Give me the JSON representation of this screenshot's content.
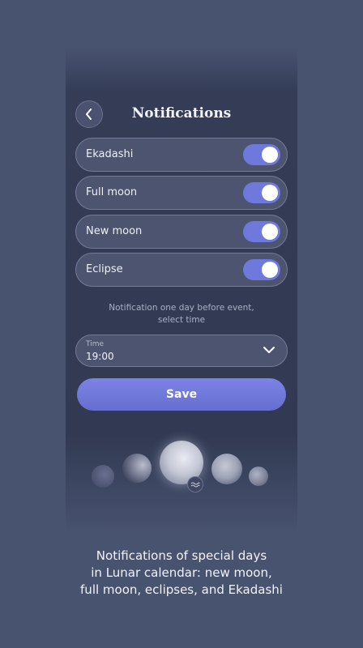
{
  "header": {
    "title": "Notifications"
  },
  "toggles": [
    {
      "label": "Ekadashi",
      "on": true
    },
    {
      "label": "Full moon",
      "on": true
    },
    {
      "label": "New moon",
      "on": true
    },
    {
      "label": "Eclipse",
      "on": true
    }
  ],
  "hint": {
    "line1": "Notification one day before event,",
    "line2": "select time"
  },
  "time": {
    "label": "Time",
    "value": "19:00"
  },
  "save_label": "Save",
  "caption": {
    "line1": "Notifications of special days",
    "line2": "in Lunar calendar: new moon,",
    "line3": "full moon, eclipses, and Ekadashi"
  },
  "colors": {
    "background": "#485370",
    "accent": "#6f79dc",
    "row": "#4c5470"
  }
}
